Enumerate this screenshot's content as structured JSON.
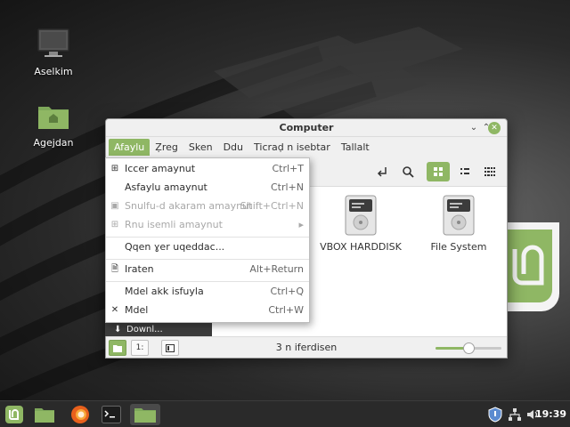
{
  "desktop": {
    "icons": [
      {
        "label": "Aselkim",
        "icon": "computer-icon"
      },
      {
        "label": "Agejdan",
        "icon": "home-folder-icon"
      }
    ]
  },
  "window": {
    "title": "Computer",
    "controls": {
      "minimize": "⌄",
      "maximize": "⌃",
      "close": "✕"
    },
    "menubar": [
      "Afaylu",
      "Ẓreg",
      "Sken",
      "Ddu",
      "Ticraḍ n isebtar",
      "Tallalt"
    ],
    "active_menu": "Afaylu",
    "items": [
      {
        "label": "VBOX HARDDISK",
        "icon": "hard-drive-icon"
      },
      {
        "label": "File System",
        "icon": "hard-drive-icon"
      }
    ],
    "status": "3 n iferdisen",
    "zoom_level": 0.5,
    "sidebar_peek": "Downl..."
  },
  "file_menu": {
    "items": [
      {
        "icon": "new-tab-icon",
        "glyph": "⊞",
        "label": "Iccer amaynut",
        "shortcut": "Ctrl+T",
        "disabled": false
      },
      {
        "icon": "",
        "glyph": "",
        "label": "Asfaylu amaynut",
        "shortcut": "Ctrl+N",
        "disabled": false
      },
      {
        "icon": "archive-icon",
        "glyph": "▣",
        "label": "Snulfu-d akaram amaynut",
        "shortcut": "Shift+Ctrl+N",
        "disabled": true
      },
      {
        "icon": "new-document-icon",
        "glyph": "⊞",
        "label": "Rnu isemli amaynut",
        "shortcut": "▸",
        "disabled": true
      },
      {
        "icon": "",
        "glyph": "",
        "label": "Qqen ɣer uqeddac...",
        "shortcut": "",
        "disabled": false
      },
      {
        "icon": "properties-icon",
        "glyph": "🗎",
        "label": "Iraten",
        "shortcut": "Alt+Return",
        "disabled": false
      },
      {
        "icon": "",
        "glyph": "",
        "label": "Mdel akk isfuyla",
        "shortcut": "Ctrl+Q",
        "disabled": false
      },
      {
        "icon": "close-icon",
        "glyph": "✕",
        "label": "Mdel",
        "shortcut": "Ctrl+W",
        "disabled": false
      }
    ]
  },
  "taskbar": {
    "time": "19:39",
    "buttons": [
      "mint-menu-icon",
      "file-manager-icon",
      "firefox-icon",
      "terminal-icon",
      "running-file-manager-icon"
    ]
  },
  "colors": {
    "accent": "#8fb764",
    "panel": "#2a2a2a"
  }
}
